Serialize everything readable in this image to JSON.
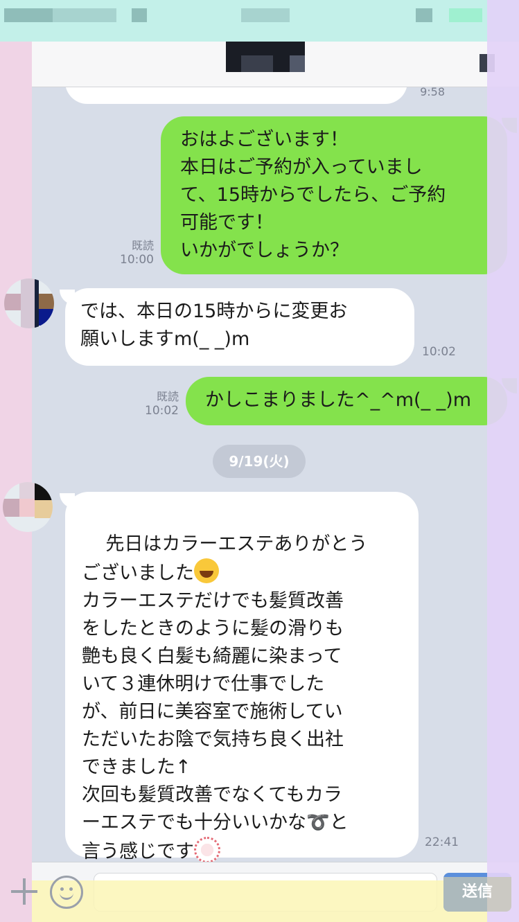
{
  "header": {
    "back_label": "",
    "contact_name": ""
  },
  "messages": [
    {
      "id": "m0",
      "direction": "in",
      "text": "",
      "time": "9:58"
    },
    {
      "id": "m1",
      "direction": "out",
      "text": "おはよございます！\n本日はご予約が入っていまし\nて、15時からでしたら、ご予約\n可能です！\nいかがでしょうか？",
      "read": "既読",
      "time": "10:00"
    },
    {
      "id": "m2",
      "direction": "in",
      "text": "では、本日の15時からに変更お\n願いしますm(_ _)m",
      "time": "10:02"
    },
    {
      "id": "m3",
      "direction": "out",
      "text": "かしこまりました^_^m(_ _)m",
      "read": "既読",
      "time": "10:02"
    },
    {
      "id": "m4",
      "direction": "in",
      "text_part1": "先日はカラーエステありがとう\nございました",
      "emoji1": "grinning-face-emoji",
      "text_part2": "\nカラーエステだけでも髪質改善\nをしたときのように髪の滑りも\n艶も良く白髪も綺麗に染まって\nいて３連休明けで仕事でした\nが、前日に美容室で施術してい\nただいたお陰で気持ち良く出社\nできました↑\n次回も髪質改善でなくてもカラ\nーエステでも十分いいかな➰と\n言う感じです",
      "emoji2": "flower-stamp-emoji",
      "time": "22:41"
    }
  ],
  "date_separator": "9/19(火)",
  "input": {
    "placeholder": "",
    "send_label": "送信"
  },
  "colors": {
    "chat_background": "#d7dde8",
    "outgoing_bubble": "#84e24c",
    "incoming_bubble": "#ffffff",
    "send_button": "#5b8fdc"
  }
}
